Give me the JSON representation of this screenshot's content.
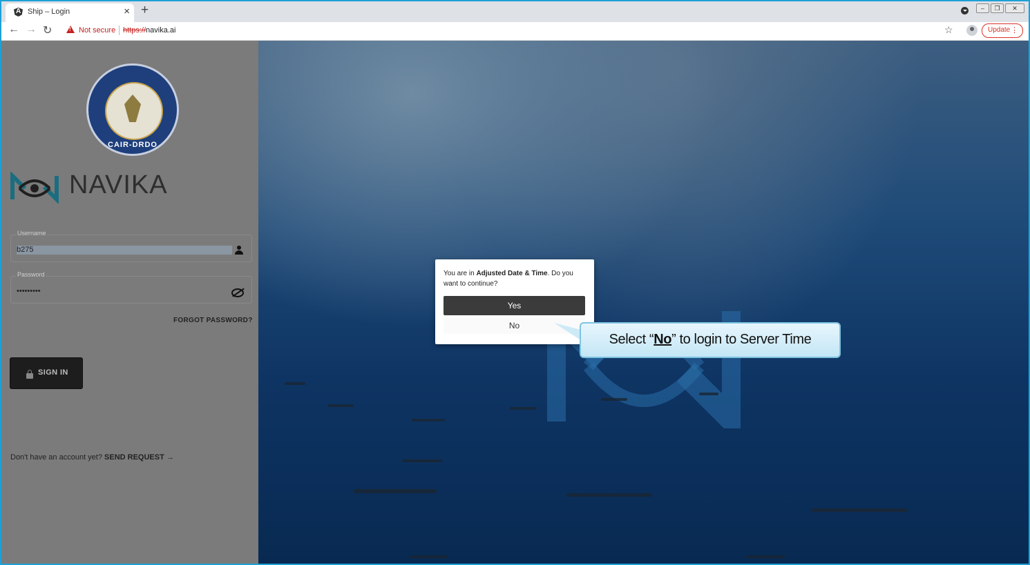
{
  "browser": {
    "tab_title": "Ship – Login",
    "security_label": "Not secure",
    "url_scheme": "https://",
    "url_host": "navika.ai",
    "update_label": "Update"
  },
  "left_panel": {
    "emblem_text": "CAIR-DRDO",
    "brand_name": "NAVIKA",
    "username": {
      "label": "Username",
      "value": "b275"
    },
    "password": {
      "label": "Password",
      "value": "•••••••••"
    },
    "forgot_label": "FORGOT PASSWORD?",
    "signin_label": "SIGN IN",
    "no_account_text": "Don't have an account yet?",
    "send_request_label": "SEND REQUEST →"
  },
  "dialog": {
    "msg_prefix": "You are in",
    "msg_bold": "Adjusted Date & Time",
    "msg_suffix": ". Do you want to continue?",
    "yes_label": "Yes",
    "no_label": "No"
  },
  "callout": {
    "prefix": "Select “",
    "highlight": "No",
    "suffix": "” to login to Server Time"
  }
}
